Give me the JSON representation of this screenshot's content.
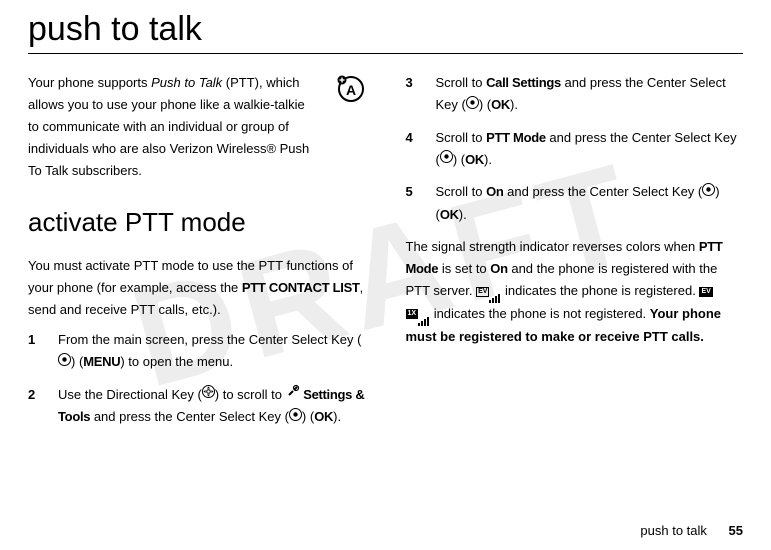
{
  "watermark": "DRAFT",
  "h1": "push to talk",
  "intro_1": "Your phone supports ",
  "intro_em": "Push to Talk",
  "intro_2": " (PTT), which allows you to use your phone like a walkie-talkie to communicate with an individual or group of individuals who are also Verizon Wireless® Push To Talk subscribers.",
  "h2": "activate PTT mode",
  "para_activate_1": "You must activate PTT mode to use the PTT functions of your phone (for example, access the ",
  "para_activate_c1": "PTT CONTACT LIST",
  "para_activate_2": ", send and receive PTT calls, etc.).",
  "steps": {
    "s1_a": "From the main screen, press the Center Select Key (",
    "s1_b": ") (",
    "s1_menu": "MENU",
    "s1_c": ") to open the menu.",
    "s2_a": "Use the Directional Key (",
    "s2_b": ") to scroll to ",
    "s2_settings": "Settings & Tools",
    "s2_c": " and press the Center Select Key (",
    "s2_d": ") (",
    "s2_ok": "OK",
    "s2_e": ").",
    "s3_a": "Scroll to ",
    "s3_call": "Call Settings",
    "s3_b": " and press the Center Select Key (",
    "s3_c": ") (",
    "s3_ok": "OK",
    "s3_d": ").",
    "s4_a": "Scroll to ",
    "s4_ptt": "PTT Mode",
    "s4_b": " and press the Center Select Key (",
    "s4_c": ") (",
    "s4_ok": "OK",
    "s4_d": ").",
    "s5_a": "Scroll to ",
    "s5_on": "On",
    "s5_b": " and press the Center Select Key (",
    "s5_c": ") (",
    "s5_ok": "OK",
    "s5_d": ")."
  },
  "signal_1": "The signal strength indicator reverses colors when ",
  "signal_c1": "PTT Mode",
  "signal_2": " is set to ",
  "signal_c2": "On",
  "signal_3": " and the phone is registered with the PTT server. ",
  "signal_4": " indicates the phone is registered. ",
  "signal_5": " indicates the phone is not registered. ",
  "signal_bold": "Your phone must be registered to make or receive PTT calls.",
  "ev_label": "EV",
  "x1_label": "1X",
  "footer_text": "push to talk",
  "page_num": "55",
  "nums": {
    "n1": "1",
    "n2": "2",
    "n3": "3",
    "n4": "4",
    "n5": "5"
  }
}
